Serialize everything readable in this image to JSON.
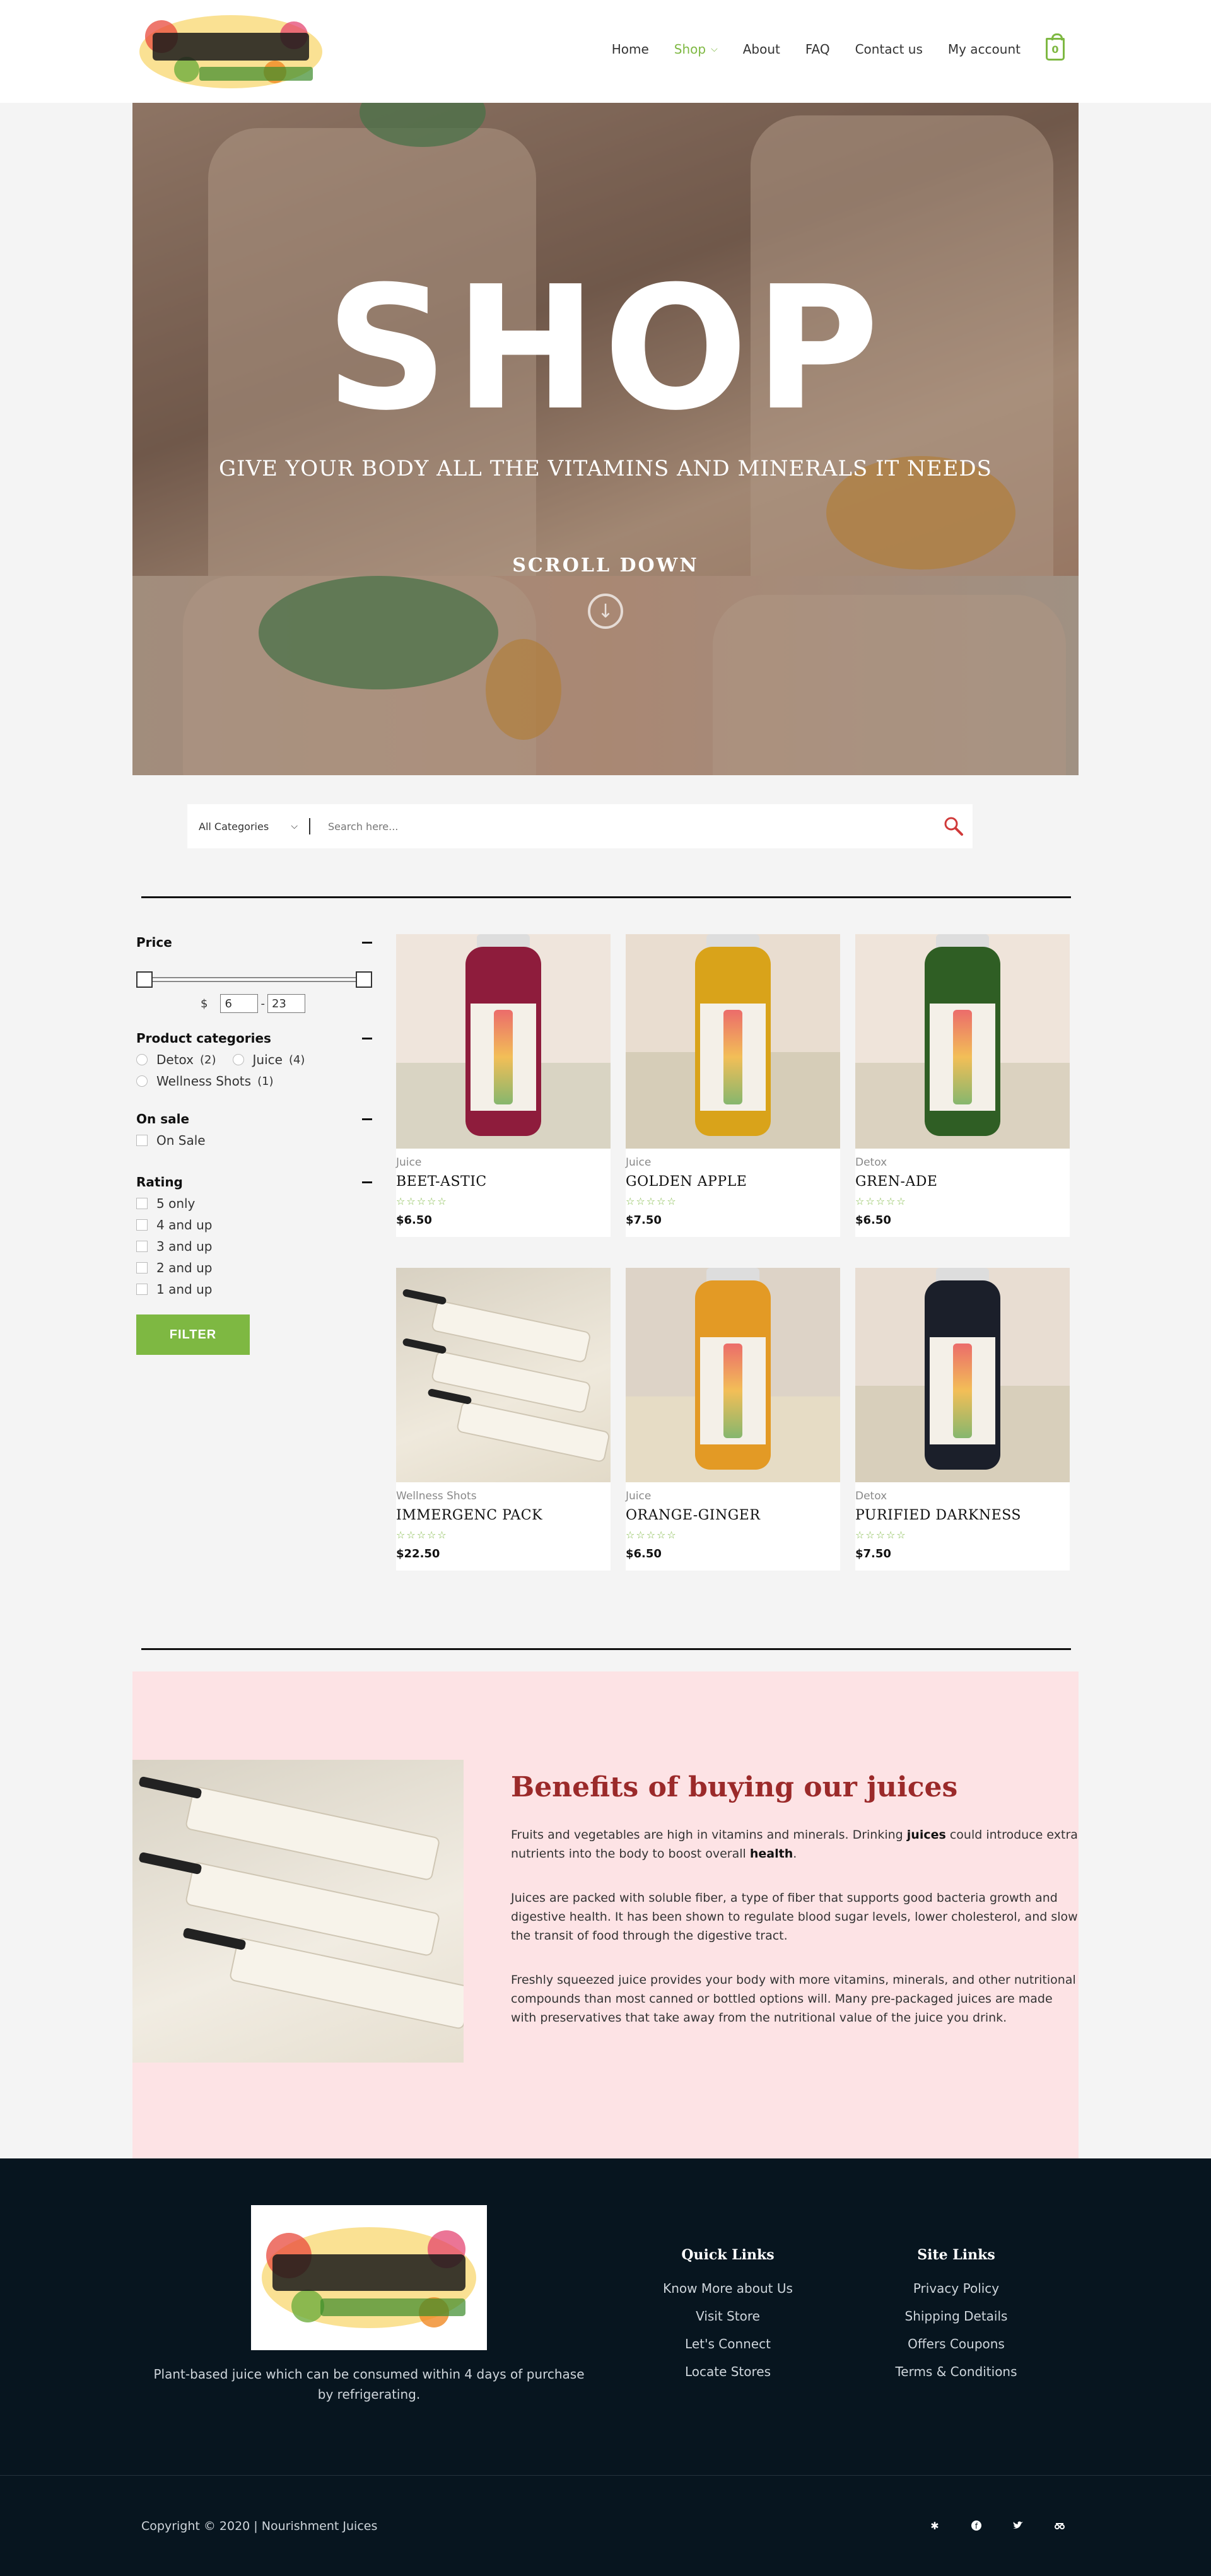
{
  "header": {
    "logo_alt": "Jus Tas It Natural Nourishment",
    "nav": [
      "Home",
      "Shop",
      "About",
      "FAQ",
      "Contact us",
      "My account"
    ],
    "cart_count": "0"
  },
  "hero": {
    "title": "SHOP",
    "subtitle": "GIVE YOUR BODY ALL THE VITAMINS AND MINERALS IT NEEDS",
    "scroll": "SCROLL DOWN"
  },
  "search": {
    "category": "All Categories",
    "placeholder": "Search here..."
  },
  "sidebar": {
    "price_title": "Price",
    "price_currency": "$",
    "price_min": "6",
    "price_max": "23",
    "categories_title": "Product categories",
    "categories": [
      {
        "label": "Detox",
        "count": "(2)"
      },
      {
        "label": "Juice",
        "count": "(4)"
      },
      {
        "label": "Wellness Shots",
        "count": "(1)"
      }
    ],
    "sale_title": "On sale",
    "sale_label": "On Sale",
    "rating_title": "Rating",
    "ratings": [
      "5 only",
      "4 and up",
      "3 and up",
      "2 and up",
      "1 and up"
    ],
    "filter_label": "FILTER"
  },
  "products": [
    {
      "category": "Juice",
      "name": "BEET-ASTIC",
      "price": "$6.50",
      "color": "#8e1c3c"
    },
    {
      "category": "Juice",
      "name": "GOLDEN APPLE",
      "price": "$7.50",
      "color": "#d9a31a"
    },
    {
      "category": "Detox",
      "name": "GREN-ADE",
      "price": "$6.50",
      "color": "#2f5e24"
    },
    {
      "category": "Wellness Shots",
      "name": "IMMERGENC PACK",
      "price": "$22.50",
      "color": "#f0ebdd"
    },
    {
      "category": "Juice",
      "name": "ORANGE-GINGER",
      "price": "$6.50",
      "color": "#e39a25"
    },
    {
      "category": "Detox",
      "name": "PURIFIED DARKNESS",
      "price": "$7.50",
      "color": "#1b1f2a"
    }
  ],
  "stars": "☆☆☆☆☆",
  "benefits": {
    "title": "Benefits of buying our juices",
    "p1_a": "Fruits and vegetables are high in vitamins and minerals. Drinking ",
    "p1_b": "juices",
    "p1_c": " could introduce extra nutrients into the body to boost overall ",
    "p1_d": "health",
    "p1_e": ".",
    "p2": "Juices are packed with soluble fiber, a type of fiber that supports good bacteria growth and digestive health. It has been shown to regulate blood sugar levels, lower cholesterol, and slow the transit of food through the digestive tract.",
    "p3": "Freshly squeezed juice provides your body with more vitamins, minerals, and other nutritional compounds than most canned or bottled options will. Many pre-packaged juices are made with preservatives that take away from the nutritional value of the juice you drink."
  },
  "footer": {
    "tagline": "Plant-based juice which can be consumed within 4 days of purchase by refrigerating.",
    "quick_title": "Quick Links",
    "quick_links": [
      "Know More about Us",
      "Visit Store",
      "Let's Connect",
      "Locate Stores"
    ],
    "site_title": "Site Links",
    "site_links": [
      "Privacy Policy",
      "Shipping Details",
      "Offers Coupons",
      "Terms & Conditions"
    ],
    "copyright": "Copyright © 2020 | Nourishment Juices",
    "socials": [
      "yelp-icon",
      "facebook-icon",
      "twitter-icon",
      "tripadvisor-icon"
    ]
  },
  "colors": {
    "accent": "#7eb842",
    "benefits_title": "#9b2a2a",
    "footer_bg": "#07151f",
    "benefits_bg": "#fde3e5"
  }
}
